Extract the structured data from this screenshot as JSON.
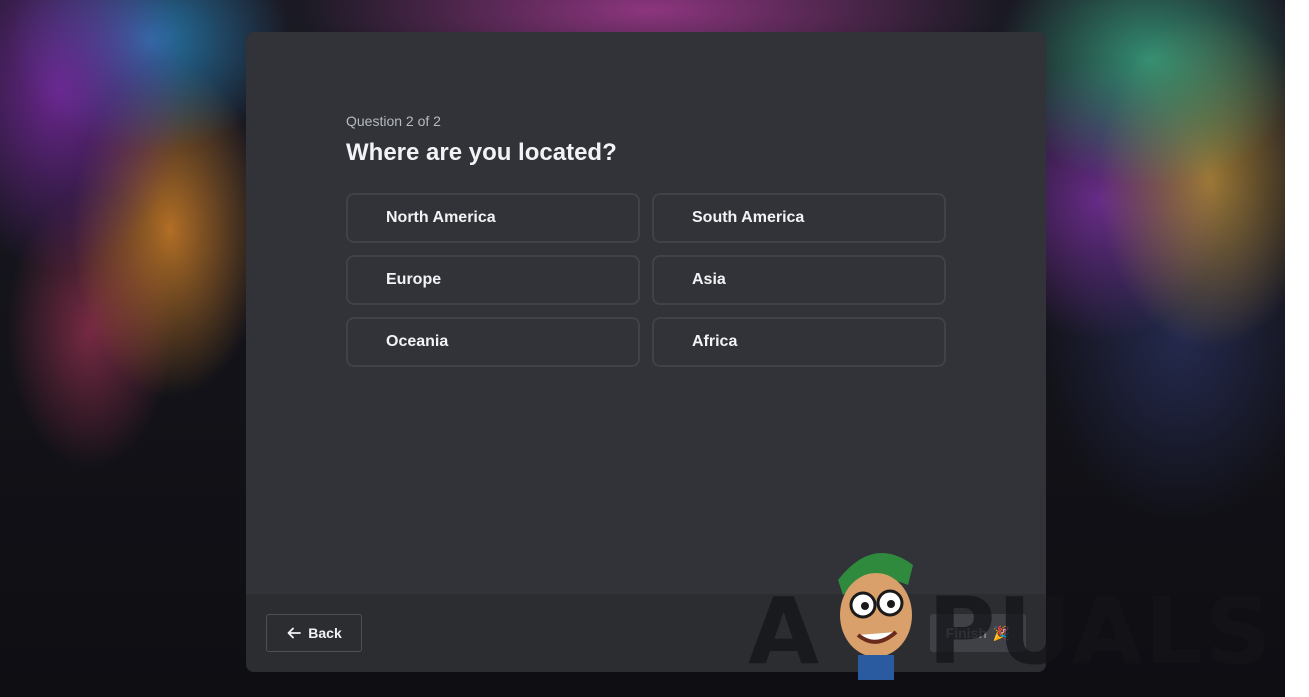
{
  "question": {
    "counter": "Question 2 of 2",
    "title": "Where are you located?"
  },
  "options": [
    {
      "label": "North America"
    },
    {
      "label": "South America"
    },
    {
      "label": "Europe"
    },
    {
      "label": "Asia"
    },
    {
      "label": "Oceania"
    },
    {
      "label": "Africa"
    }
  ],
  "footer": {
    "back_label": "Back",
    "back_icon": "arrow-left-icon",
    "finish_label": "Finish",
    "finish_icon": "party-popper-icon",
    "finish_disabled": true
  },
  "watermark": {
    "text": "APPUALS"
  },
  "colors": {
    "modal_bg": "#313338",
    "footer_bg": "#2b2d31",
    "option_border": "#404249",
    "text_primary": "#f2f3f5",
    "text_muted": "#b5bac1"
  }
}
